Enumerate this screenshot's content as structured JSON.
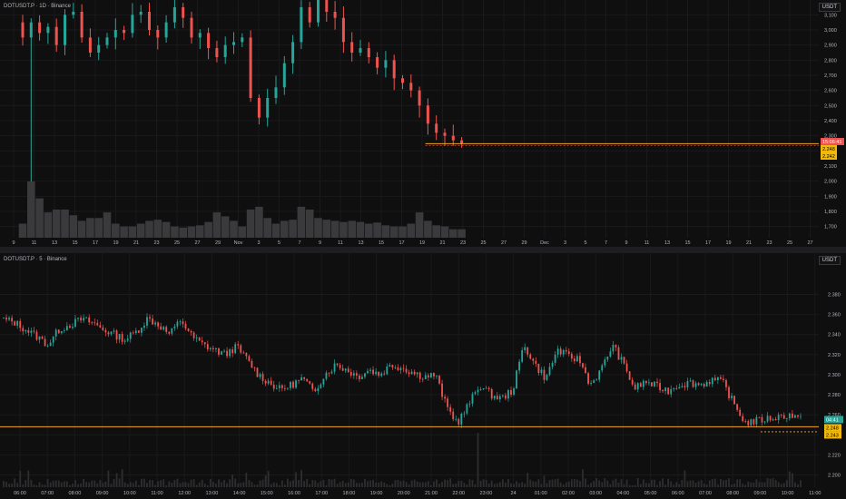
{
  "top_panel": {
    "title": "DOTUSDT.P · 1D · Binance",
    "unit": "USDT",
    "price_ticks": [
      "3,100",
      "3,000",
      "2,900",
      "2,800",
      "2,700",
      "2,600",
      "2,500",
      "2,400",
      "2,300",
      "2,200",
      "2,100",
      "2,000",
      "1,900",
      "1,800",
      "1,700"
    ],
    "date_ticks": [
      "9",
      "11",
      "13",
      "15",
      "17",
      "19",
      "21",
      "23",
      "25",
      "27",
      "29",
      "Nov",
      "3",
      "5",
      "7",
      "9",
      "11",
      "13",
      "15",
      "17",
      "19",
      "21",
      "23",
      "25",
      "27",
      "29",
      "Dec",
      "3",
      "5",
      "7",
      "9",
      "11",
      "13",
      "15",
      "17",
      "19",
      "21",
      "23",
      "25",
      "27"
    ],
    "countdown_badge": "15:06:41",
    "price_badge_1": "2.248",
    "price_badge_2": "2.242"
  },
  "bottom_panel": {
    "title": "DOTUSDT.P · 5 · Binance",
    "unit": "USDT",
    "price_ticks": [
      "2.380",
      "2.360",
      "2.340",
      "2.320",
      "2.300",
      "2.280",
      "2.260",
      "2.240",
      "2.220",
      "2.200"
    ],
    "time_ticks": [
      "06:00",
      "07:00",
      "08:00",
      "09:00",
      "10:00",
      "11:00",
      "12:00",
      "13:00",
      "14:00",
      "15:00",
      "16:00",
      "17:00",
      "18:00",
      "19:00",
      "20:00",
      "21:00",
      "22:00",
      "23:00",
      "24",
      "01:00",
      "02:00",
      "03:00",
      "04:00",
      "05:00",
      "06:00",
      "07:00",
      "08:00",
      "09:00",
      "10:00",
      "11:00"
    ],
    "countdown_badge": "04:41",
    "price_badge_1": "2.248",
    "price_badge_2": "2.243"
  },
  "colors": {
    "background": "#0f0f10",
    "up": "#26a69a",
    "down": "#ef5350",
    "level_line": "#f5a623",
    "badge_red": "#ef5350",
    "badge_yellow": "#f0b90b",
    "badge_teal": "#26a69a"
  },
  "chart_data": [
    {
      "type": "candlestick",
      "title": "DOTUSDT.P · 1D · Binance",
      "ylabel": "USDT",
      "ylim": [
        1.65,
        3.15
      ],
      "last_price": 2.248,
      "secondary_price": 2.242,
      "close": [
        2.95,
        3.05,
        2.98,
        3.02,
        2.9,
        3.1,
        3.12,
        2.95,
        2.85,
        2.9,
        2.95,
        3.0,
        2.98,
        3.1,
        3.12,
        3.0,
        2.95,
        3.05,
        3.15,
        3.08,
        2.95,
        2.98,
        2.88,
        2.82,
        2.9,
        2.92,
        2.95,
        2.55,
        2.42,
        2.55,
        2.62,
        2.78,
        2.92,
        3.15,
        3.05,
        3.2,
        3.12,
        3.08,
        2.92,
        2.85,
        2.88,
        2.82,
        2.75,
        2.8,
        2.68,
        2.65,
        2.6,
        2.5,
        2.38,
        2.32,
        2.3,
        2.27,
        2.25
      ],
      "volume_relative": [
        0.25,
        1.0,
        0.7,
        0.45,
        0.5,
        0.5,
        0.4,
        0.3,
        0.35,
        0.35,
        0.45,
        0.25,
        0.2,
        0.2,
        0.25,
        0.3,
        0.32,
        0.28,
        0.2,
        0.18,
        0.2,
        0.22,
        0.28,
        0.45,
        0.38,
        0.3,
        0.2,
        0.5,
        0.55,
        0.35,
        0.25,
        0.3,
        0.32,
        0.55,
        0.5,
        0.35,
        0.32,
        0.3,
        0.28,
        0.3,
        0.28,
        0.25,
        0.27,
        0.22,
        0.2,
        0.2,
        0.25,
        0.45,
        0.3,
        0.22,
        0.2,
        0.15,
        0.15
      ]
    },
    {
      "type": "candlestick",
      "title": "DOTUSDT.P · 5 · Binance",
      "ylabel": "USDT",
      "ylim": [
        2.195,
        2.385
      ],
      "last_price": 2.248,
      "secondary_price": 2.243,
      "close_anchors": [
        2.355,
        2.352,
        2.345,
        2.338,
        2.33,
        2.345,
        2.35,
        2.355,
        2.352,
        2.345,
        2.34,
        2.335,
        2.343,
        2.356,
        2.35,
        2.34,
        2.355,
        2.338,
        2.33,
        2.325,
        2.32,
        2.328,
        2.315,
        2.3,
        2.292,
        2.285,
        2.29,
        2.296,
        2.283,
        2.3,
        2.31,
        2.305,
        2.298,
        2.305,
        2.3,
        2.31,
        2.307,
        2.302,
        2.298,
        2.3,
        2.268,
        2.252,
        2.27,
        2.29,
        2.28,
        2.276,
        2.285,
        2.33,
        2.31,
        2.296,
        2.325,
        2.318,
        2.315,
        2.29,
        2.305,
        2.33,
        2.31,
        2.286,
        2.293,
        2.288,
        2.284,
        2.29,
        2.292,
        2.29,
        2.295,
        2.292,
        2.27,
        2.252,
        2.254,
        2.256,
        2.258,
        2.26,
        2.255
      ]
    }
  ]
}
